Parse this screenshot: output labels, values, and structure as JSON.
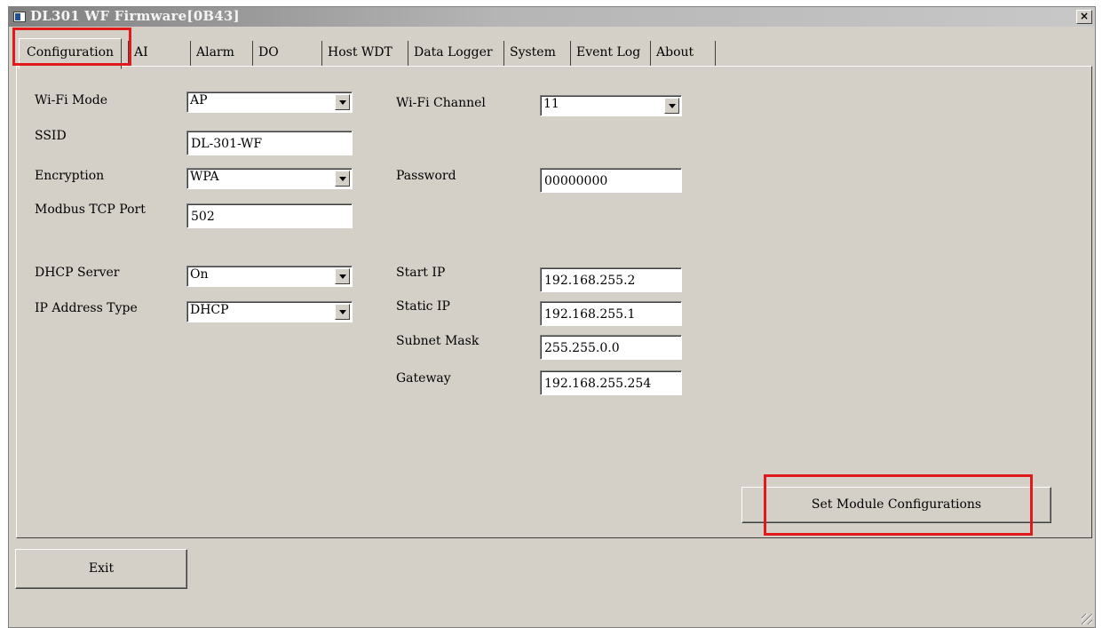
{
  "window": {
    "title": "DL301 WF Firmware[0B43]",
    "close_glyph": "×"
  },
  "tabs": [
    {
      "label": "Configuration",
      "active": true
    },
    {
      "label": "AI"
    },
    {
      "label": "Alarm"
    },
    {
      "label": "DO"
    },
    {
      "label": "Host WDT"
    },
    {
      "label": "Data Logger"
    },
    {
      "label": "System"
    },
    {
      "label": "Event Log"
    },
    {
      "label": "About"
    }
  ],
  "config": {
    "wifi_mode": {
      "label": "Wi-Fi Mode",
      "value": "AP"
    },
    "ssid": {
      "label": "SSID",
      "value": "DL-301-WF"
    },
    "encryption": {
      "label": "Encryption",
      "value": "WPA"
    },
    "modbus_port": {
      "label": "Modbus TCP Port",
      "value": "502"
    },
    "dhcp_server": {
      "label": "DHCP Server",
      "value": "On"
    },
    "ip_type": {
      "label": "IP Address Type",
      "value": "DHCP"
    },
    "wifi_channel": {
      "label": "Wi-Fi Channel",
      "value": "11"
    },
    "password": {
      "label": "Password",
      "value": "00000000"
    },
    "start_ip": {
      "label": "Start IP",
      "value": "192.168.255.2"
    },
    "static_ip": {
      "label": "Static IP",
      "value": "192.168.255.1"
    },
    "subnet_mask": {
      "label": "Subnet Mask",
      "value": "255.255.0.0"
    },
    "gateway": {
      "label": "Gateway",
      "value": "192.168.255.254"
    }
  },
  "buttons": {
    "set_config": "Set Module Configurations",
    "exit": "Exit"
  },
  "colors": {
    "highlight": "#e01a1a",
    "window_bg": "#d4d0c8"
  }
}
